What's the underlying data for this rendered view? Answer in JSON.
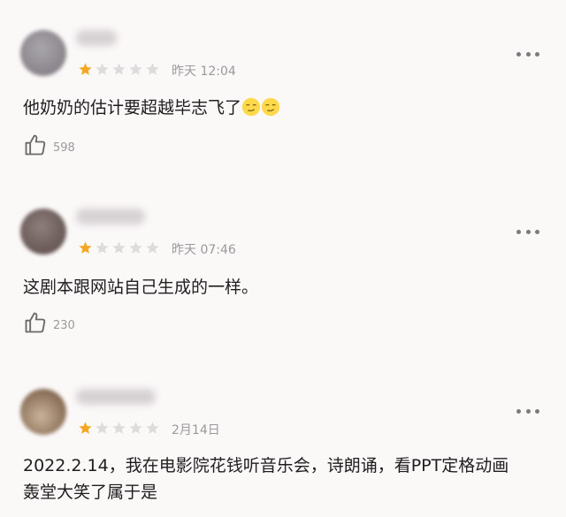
{
  "colors": {
    "star_filled": "#f5a623",
    "star_empty": "#dcdcdc",
    "meta_text": "#9a9a9a",
    "background": "#fbf8f8"
  },
  "comments": [
    {
      "rating": 1,
      "time": "昨天 12:04",
      "text": "他奶奶的估计要超越毕志飞了",
      "emojis": [
        "smirk-emoji",
        "smirk-emoji"
      ],
      "likes": "598",
      "avatar_color": "#8c8890"
    },
    {
      "rating": 1,
      "time": "昨天 07:46",
      "text": "这剧本跟网站自己生成的一样。",
      "emojis": [],
      "likes": "230",
      "avatar_color": "#6e5a58"
    },
    {
      "rating": 1,
      "time": "2月14日",
      "text": "2022.2.14，我在电影院花钱听音乐会，诗朗诵，看PPT定格动画\n轰堂大笑了属于是",
      "emojis": [],
      "likes": "",
      "avatar_color": "#9a7a5c"
    }
  ]
}
